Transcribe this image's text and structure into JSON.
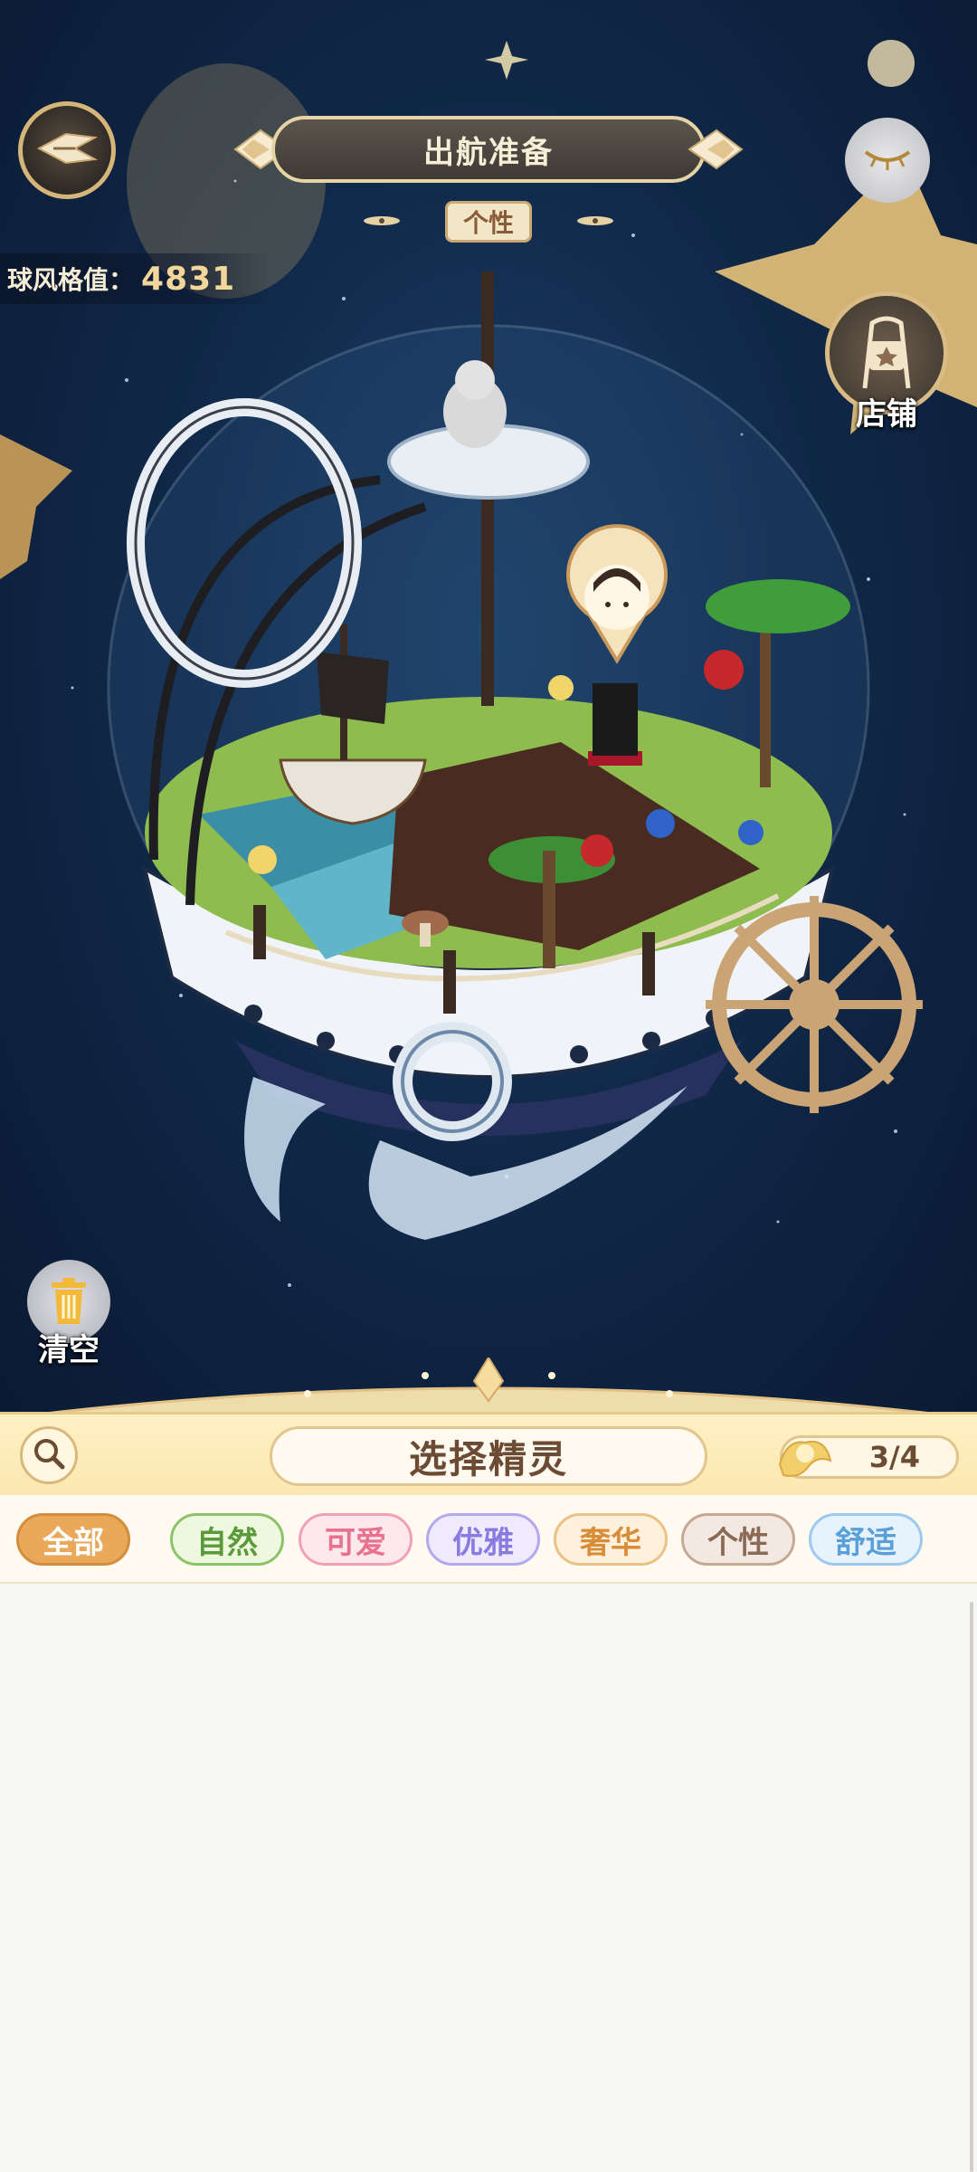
{
  "header": {
    "title": "出航准备",
    "style_tag": "个性"
  },
  "score": {
    "label": "球风格值：",
    "value": "4831"
  },
  "shop": {
    "label": "店铺"
  },
  "clear": {
    "label": "清空"
  },
  "panel": {
    "title": "选择精灵",
    "counter": "3/4",
    "filters": [
      {
        "label": "全部",
        "active": true,
        "color": "#ffffff",
        "bg": "#e9a85a",
        "border": "#d48d3d"
      },
      {
        "label": "自然",
        "color": "#5b9a3a",
        "bg": "#eef8df",
        "border": "#8cc26a"
      },
      {
        "label": "可爱",
        "color": "#e9718e",
        "bg": "#fde8ee",
        "border": "#f2a1b5"
      },
      {
        "label": "优雅",
        "color": "#8a7be0",
        "bg": "#efeafc",
        "border": "#b4a8ef"
      },
      {
        "label": "奢华",
        "color": "#d88d3a",
        "bg": "#fdf1dc",
        "border": "#ebc187"
      },
      {
        "label": "个性",
        "color": "#8a6a55",
        "bg": "#f3e9e2",
        "border": "#c6a894"
      },
      {
        "label": "舒适",
        "color": "#5b9fd9",
        "bg": "#e6f2fc",
        "border": "#9cc9ef"
      }
    ]
  },
  "colors": {
    "night_sky": "#11294a",
    "panel_accent": "#e9c98b",
    "gold": "#f3d79a"
  },
  "icons": {
    "back": "back-arrow-icon",
    "toggle": "eye-closed-icon",
    "shop": "shop-stand-icon",
    "clear": "trash-can-icon",
    "search": "search-icon",
    "counter": "fairy-icon"
  }
}
